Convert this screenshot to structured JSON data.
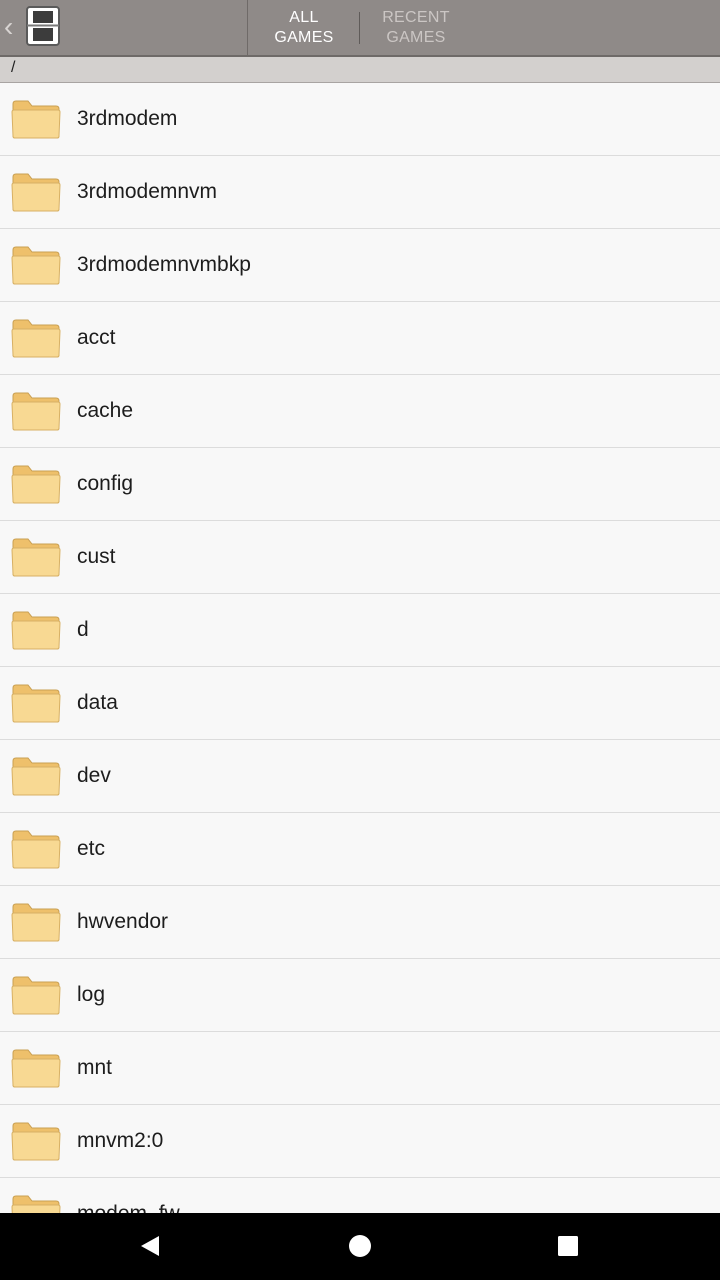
{
  "header": {
    "tabs": [
      {
        "label_line1": "ALL",
        "label_line2": "GAMES"
      },
      {
        "label_line1": "RECENT",
        "label_line2": "GAMES"
      }
    ]
  },
  "path": "/",
  "folders": [
    "3rdmodem",
    "3rdmodemnvm",
    "3rdmodemnvmbkp",
    "acct",
    "cache",
    "config",
    "cust",
    "d",
    "data",
    "dev",
    "etc",
    "hwvendor",
    "log",
    "mnt",
    "mnvm2:0",
    "modem_fw"
  ],
  "icons": {
    "back": "chevron-left-icon",
    "app": "nintendo-ds-icon",
    "folder": "folder-icon",
    "nav_back": "triangle-back-icon",
    "nav_home": "circle-home-icon",
    "nav_recents": "square-recents-icon"
  },
  "colors": {
    "header_bg": "#8f8a88",
    "path_bg": "#d3d0ce",
    "list_bg": "#f8f8f8",
    "folder_fill": "#f6d48c"
  }
}
